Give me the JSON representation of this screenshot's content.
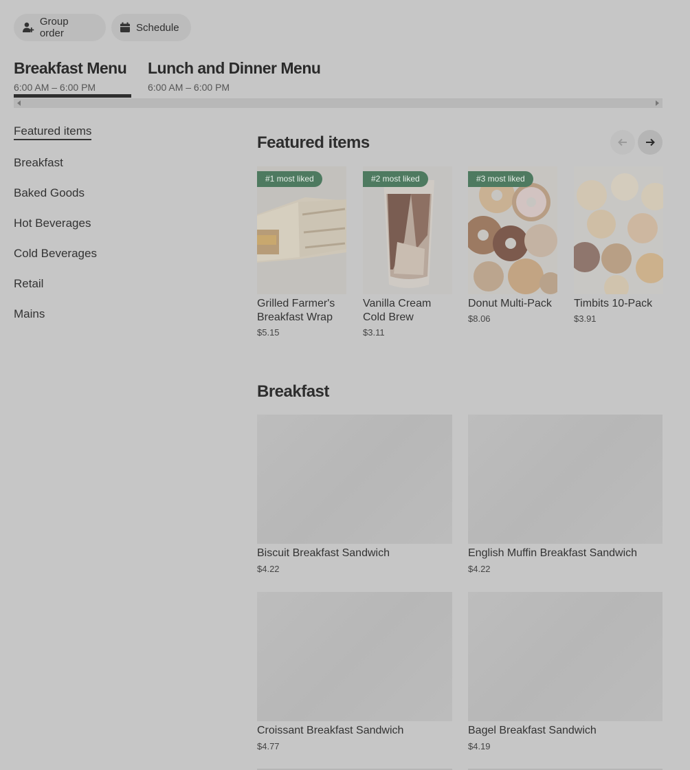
{
  "top_actions": {
    "group_order": "Group order",
    "schedule": "Schedule"
  },
  "menus": [
    {
      "title": "Breakfast Menu",
      "hours": "6:00 AM – 6:00 PM"
    },
    {
      "title": "Lunch and Dinner Menu",
      "hours": "6:00 AM – 6:00 PM"
    }
  ],
  "categories": [
    "Featured items",
    "Breakfast",
    "Baked Goods",
    "Hot Beverages",
    "Cold Beverages",
    "Retail",
    "Mains"
  ],
  "featured": {
    "title": "Featured items",
    "items": [
      {
        "badge": "#1 most liked",
        "name": "Grilled Farmer's Breakfast Wrap",
        "price": "$5.15"
      },
      {
        "badge": "#2 most liked",
        "name": "Vanilla Cream Cold Brew",
        "price": "$3.11"
      },
      {
        "badge": "#3 most liked",
        "name": "Donut Multi-Pack",
        "price": "$8.06"
      },
      {
        "name": "Timbits 10-Pack",
        "price": "$3.91"
      }
    ]
  },
  "breakfast": {
    "title": "Breakfast",
    "items": [
      {
        "name": "Biscuit Breakfast Sandwich",
        "price": "$4.22"
      },
      {
        "name": "English Muffin Breakfast Sandwich",
        "price": "$4.22"
      },
      {
        "name": "Croissant Breakfast Sandwich",
        "price": "$4.77"
      },
      {
        "name": "Bagel Breakfast Sandwich",
        "price": "$4.19"
      }
    ]
  }
}
